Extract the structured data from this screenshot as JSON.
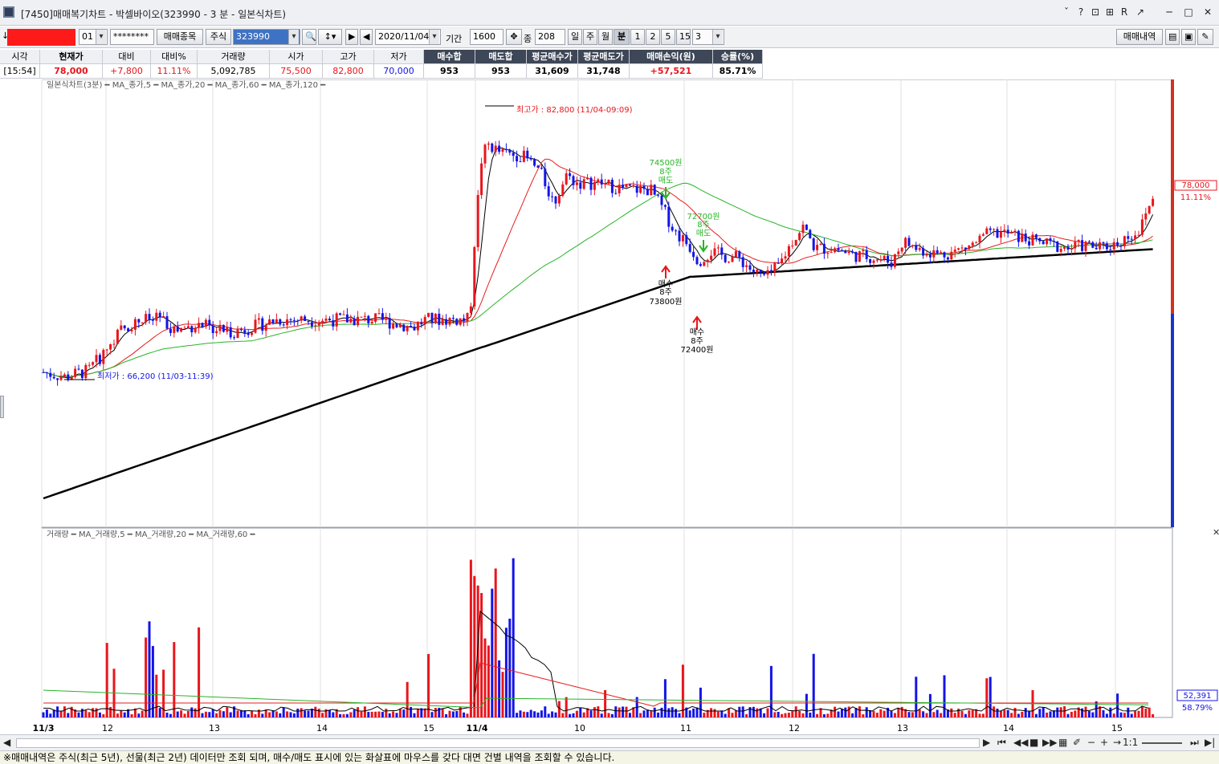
{
  "window": {
    "title": "[7450]매매복기차트 - 박셀바이오(323990 - 3 분 - 일본식차트)",
    "controls": [
      "ˇ",
      "?",
      "⊡",
      "⊞",
      "R",
      "↗",
      "─",
      "□",
      "✕"
    ]
  },
  "toolbar": {
    "arrow": "↓",
    "account_suffix": "01",
    "password": "********",
    "trade_items_btn": "매매종목",
    "market": "주식",
    "code": "323990",
    "date": "2020/11/04",
    "period_label": "기간",
    "period_value": "1600",
    "count_label": "종",
    "count_value": "208",
    "tf_day": "일",
    "tf_week": "주",
    "tf_month": "월",
    "tf_min": "분",
    "tf_1": "1",
    "tf_2": "2",
    "tf_5": "5",
    "tf_15": "15",
    "tf_value": "3",
    "history_btn": "매매내역"
  },
  "quote": {
    "headers": [
      "시각",
      "현재가",
      "대비",
      "대비%",
      "거래량",
      "시가",
      "고가",
      "저가",
      "매수합",
      "매도합",
      "평균매수가",
      "평균매도가",
      "매매손익(원)",
      "승률(%)"
    ],
    "values": [
      "[15:54]",
      "78,000",
      "+7,800",
      "11.11%",
      "5,092,785",
      "75,500",
      "82,800",
      "70,000",
      "953",
      "953",
      "31,609",
      "31,748",
      "+57,521",
      "85.71%"
    ]
  },
  "chart_data": {
    "type": "candlestick",
    "symbol": "박셀바이오",
    "price_legend": "일본식차트(3분) ━ MA_종가,5 ━ MA_종가,20 ━ MA_종가,60 ━ MA_종가,120 ━",
    "volume_legend": "거래량 ━ MA_거래량,5 ━ MA_거래량,20 ━ MA_거래량,60 ━",
    "x_labels": [
      "11/3",
      "12",
      "13",
      "14",
      "15",
      "11/4",
      "10",
      "11",
      "12",
      "13",
      "14",
      "15"
    ],
    "current_price": "78,000",
    "current_change_pct": "11.11%",
    "current_volume": "52,391",
    "current_volume_pct": "58.79%",
    "high_annotation": "최고가 : 82,800 (11/04-09:09)",
    "low_annotation": "최저가 : 66,200 (11/03-11:39)",
    "price_ylim": [
      56600,
      82800
    ],
    "colors": {
      "up": "#e8161c",
      "down": "#1414e6",
      "ma5": "#000000",
      "ma20": "#e61e1e",
      "ma60": "#28b428",
      "ma120": "#000000"
    },
    "trades": [
      {
        "side": "매도",
        "qty": "8주",
        "price": "74500원"
      },
      {
        "side": "매수",
        "qty": "8주",
        "price": "73800원"
      },
      {
        "side": "매도",
        "qty": "8주",
        "price": "72700원"
      },
      {
        "side": "매수",
        "qty": "8주",
        "price": "72400원"
      }
    ]
  },
  "status": {
    "message": "※매매내역은 주식(최근 5년), 선물(최근 2년) 데이터만 조회 되며, 매수/매도 표시에 있는 화살표에 마우스를 갖다 대면 건별 내역을 조회할 수 있습니다."
  }
}
